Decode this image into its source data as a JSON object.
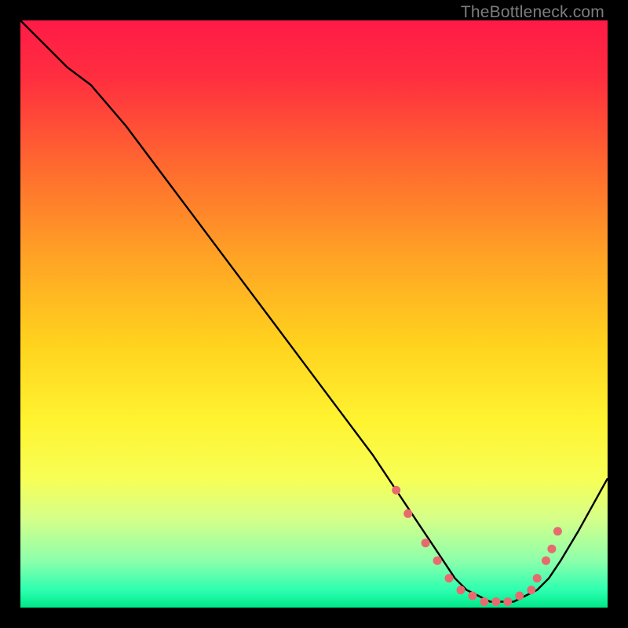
{
  "watermark": "TheBottleneck.com",
  "chart_data": {
    "type": "line",
    "title": "",
    "xlabel": "",
    "ylabel": "",
    "xlim": [
      0,
      100
    ],
    "ylim": [
      0,
      100
    ],
    "gradient_stops": [
      {
        "offset": 0.0,
        "color": "#ff1a47"
      },
      {
        "offset": 0.1,
        "color": "#ff2f3f"
      },
      {
        "offset": 0.25,
        "color": "#ff6a2f"
      },
      {
        "offset": 0.4,
        "color": "#ffa225"
      },
      {
        "offset": 0.55,
        "color": "#ffd21e"
      },
      {
        "offset": 0.68,
        "color": "#fff330"
      },
      {
        "offset": 0.78,
        "color": "#f7ff55"
      },
      {
        "offset": 0.85,
        "color": "#d4ff8a"
      },
      {
        "offset": 0.92,
        "color": "#8dffab"
      },
      {
        "offset": 0.97,
        "color": "#2dffb0"
      },
      {
        "offset": 1.0,
        "color": "#00e888"
      }
    ],
    "series": [
      {
        "name": "bottleneck-curve",
        "color": "#000000",
        "x": [
          0,
          4,
          8,
          12,
          18,
          24,
          30,
          36,
          42,
          48,
          54,
          60,
          64,
          68,
          70,
          72,
          74,
          76,
          78,
          80,
          82,
          84,
          86,
          88,
          90,
          92,
          95,
          100
        ],
        "y": [
          100,
          96,
          92,
          89,
          82,
          74,
          66,
          58,
          50,
          42,
          34,
          26,
          20,
          14,
          11,
          8,
          5,
          3,
          2,
          1,
          1,
          1,
          2,
          3,
          5,
          8,
          13,
          22
        ]
      }
    ],
    "markers": {
      "name": "highlight-dots",
      "color": "#e86a6f",
      "radius": 5.5,
      "x": [
        64,
        66,
        69,
        71,
        73,
        75,
        77,
        79,
        81,
        83,
        85,
        87,
        88,
        89.5,
        90.5,
        91.5
      ],
      "y": [
        20,
        16,
        11,
        8,
        5,
        3,
        2,
        1,
        1,
        1,
        2,
        3,
        5,
        8,
        10,
        13
      ]
    }
  }
}
